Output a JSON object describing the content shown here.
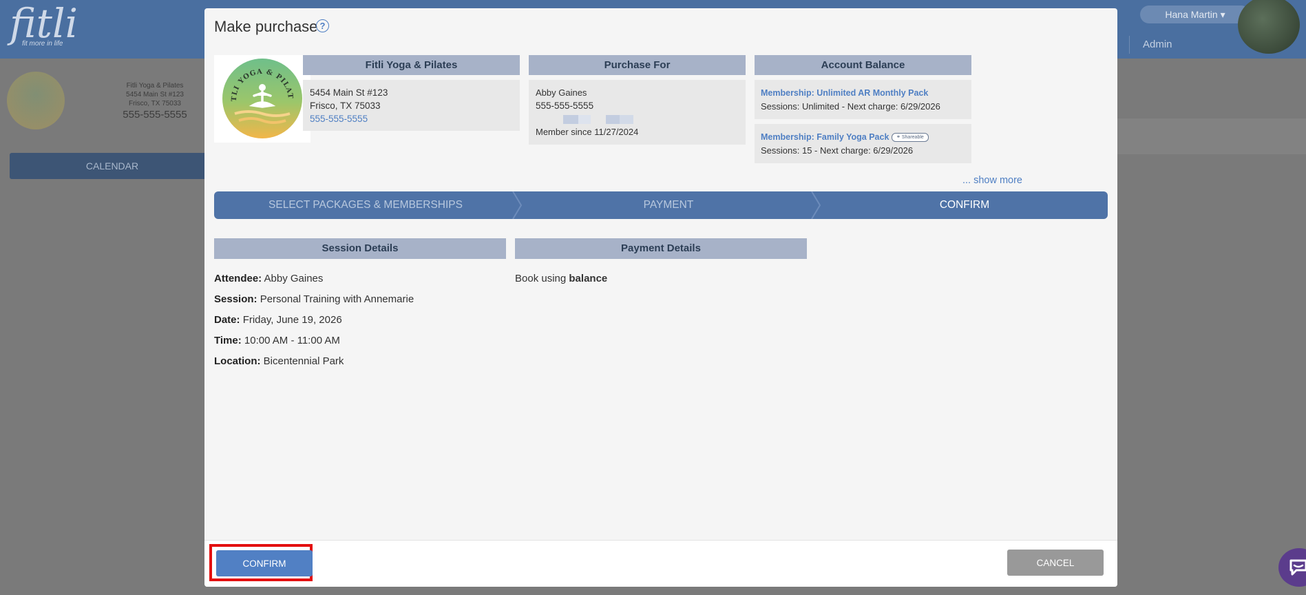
{
  "background": {
    "logo_text": "fitli",
    "logo_tagline": "fit more in life",
    "user_name": "Hana Martin",
    "admin_label": "Admin",
    "studio": {
      "name": "Fitli Yoga & Pilates",
      "address1": "5454 Main St #123",
      "address2": "Frisco, TX 75033",
      "phone": "555-555-5555"
    },
    "calendar_label": "CALENDAR"
  },
  "modal": {
    "title": "Make purchase",
    "help_icon_glyph": "?",
    "studio_card": {
      "header": "Fitli Yoga & Pilates",
      "address1": "5454 Main St #123",
      "address2": "Frisco, TX 75033",
      "phone": "555-555-5555",
      "logo_text": "FITLI YOGA & PILATES"
    },
    "purchase_for": {
      "header": "Purchase For",
      "name": "Abby Gaines",
      "phone": "555-555-5555",
      "member_since": "Member since 11/27/2024"
    },
    "account_balance": {
      "header": "Account Balance",
      "items": [
        {
          "name": "Membership: Unlimited AR Monthly Pack",
          "details": "Sessions: Unlimited -  Next charge: 6/29/2026",
          "badge": ""
        },
        {
          "name": "Membership: Family Yoga Pack",
          "details": "Sessions: 15 -  Next charge: 6/29/2026",
          "badge": "Shareable"
        }
      ],
      "show_more": "... show more"
    },
    "steps": [
      {
        "label": "SELECT PACKAGES & MEMBERSHIPS",
        "active": false
      },
      {
        "label": "PAYMENT",
        "active": false
      },
      {
        "label": "CONFIRM",
        "active": true
      }
    ],
    "session_details": {
      "header": "Session Details",
      "attendee_label": "Attendee:",
      "attendee": "Abby Gaines",
      "session_label": "Session:",
      "session": "Personal Training with Annemarie",
      "date_label": "Date:",
      "date": "Friday, June 19, 2026",
      "time_label": "Time:",
      "time": "10:00 AM - 11:00 AM",
      "location_label": "Location:",
      "location": "Bicentennial Park"
    },
    "payment_details": {
      "header": "Payment Details",
      "text_prefix": "Book using",
      "text_method": "balance"
    },
    "footer": {
      "confirm_label": "CONFIRM",
      "cancel_label": "CANCEL"
    }
  },
  "colors": {
    "primary": "#4f73a7",
    "link": "#4f7fc3",
    "section_header": "#a7b2c8",
    "highlight": "#e30f0f"
  }
}
